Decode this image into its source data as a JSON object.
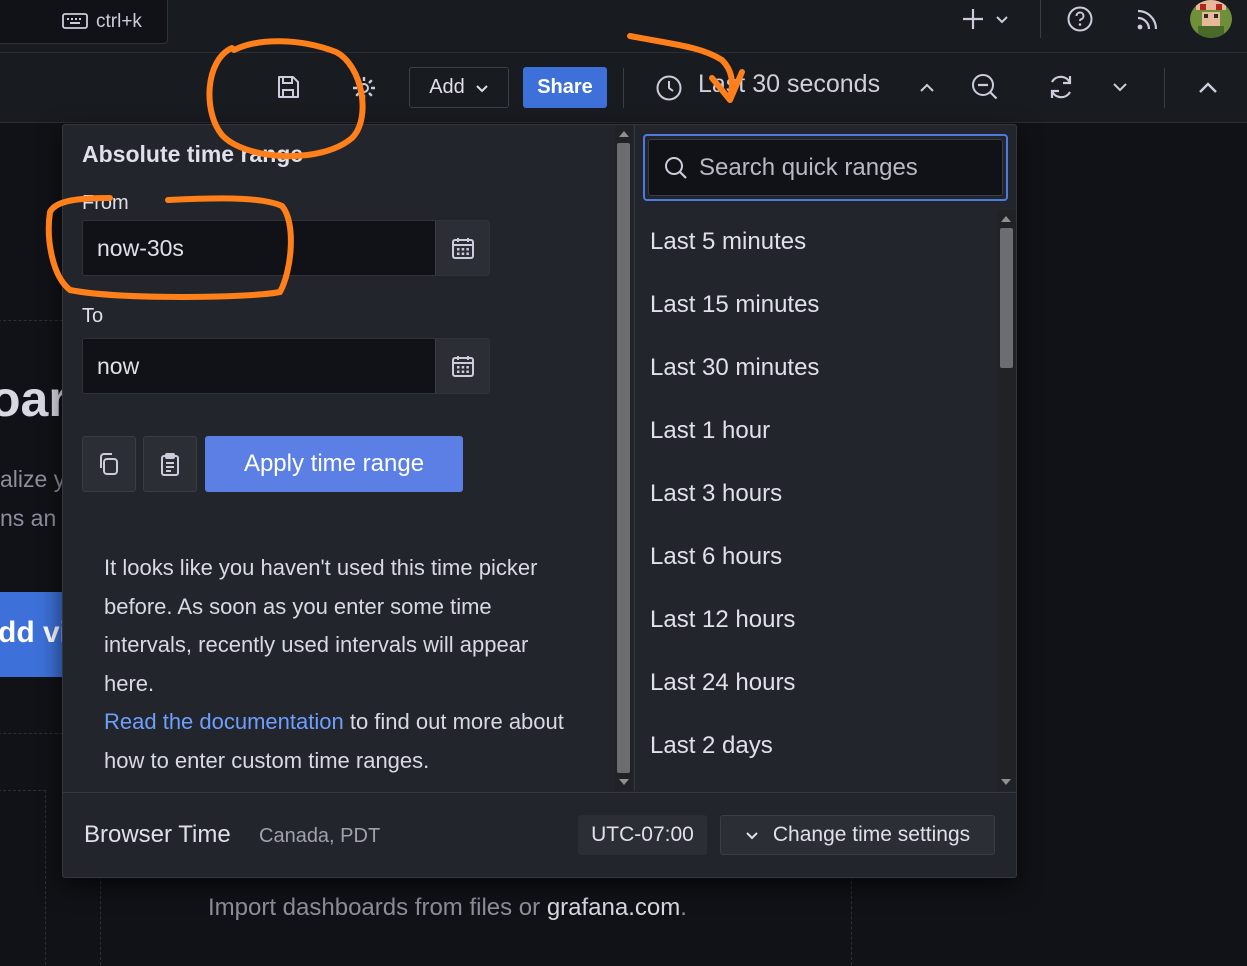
{
  "topbar": {
    "shortcut_label": "ctrl+k"
  },
  "toolbar": {
    "add_label": "Add",
    "share_label": "Share",
    "time_range_label": "Last 30 seconds"
  },
  "background": {
    "big_text": "oard",
    "line1": "alize y",
    "line2": "ns an",
    "blue_button": "dd vi",
    "import_prefix": "Import dashboards from files or ",
    "import_link": "grafana.com",
    "import_suffix": "."
  },
  "timepicker": {
    "absolute_title": "Absolute time range",
    "from_label": "From",
    "from_value": "now-30s",
    "to_label": "To",
    "to_value": "now",
    "apply_label": "Apply time range",
    "info_text": "It looks like you haven't used this time picker before. As soon as you enter some time intervals, recently used intervals will appear here.",
    "info_link": "Read the documentation",
    "info_suffix": " to find out more about how to enter custom time ranges.",
    "search_placeholder": "Search quick ranges",
    "quick_ranges": [
      "Last 5 minutes",
      "Last 15 minutes",
      "Last 30 minutes",
      "Last 1 hour",
      "Last 3 hours",
      "Last 6 hours",
      "Last 12 hours",
      "Last 24 hours",
      "Last 2 days"
    ],
    "timezone_name": "Browser Time",
    "timezone_location": "Canada, PDT",
    "timezone_offset": "UTC-07:00",
    "change_settings_label": "Change time settings"
  },
  "colors": {
    "accent": "#3d71d9",
    "apply": "#5b7fe4",
    "annotation": "#ff7f1a",
    "link": "#6e9fff"
  }
}
